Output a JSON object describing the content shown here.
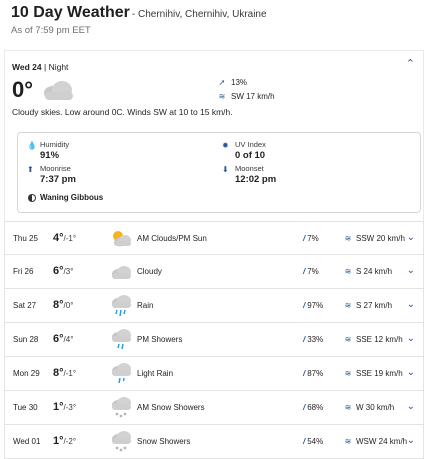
{
  "header": {
    "title": "10 Day Weather",
    "location": "- Chernihiv, Chernihiv, Ukraine",
    "as_of": "As of 7:59 pm EET"
  },
  "today": {
    "day": "Wed 24",
    "separator": "|",
    "period": "Night",
    "temp": "0°",
    "precip": "13%",
    "wind": "SW 17 km/h",
    "summary": "Cloudy skies. Low around 0C. Winds SW at 10 to 15 km/h.",
    "humidity_label": "Humidity",
    "humidity_value": "91%",
    "uv_label": "UV Index",
    "uv_value": "0 of 10",
    "moonrise_label": "Moonrise",
    "moonrise_value": "7:37 pm",
    "moonset_label": "Moonset",
    "moonset_value": "12:02 pm",
    "moon_phase": "Waning Gibbous",
    "collapse_icon": "chevron-up-icon"
  },
  "days": [
    {
      "day": "Thu 25",
      "hi": "4°",
      "lo": "/-1°",
      "icon": "partly-cloudy-icon",
      "cond": "AM Clouds/PM Sun",
      "precip": "7%",
      "wind": "SSW 20 km/h"
    },
    {
      "day": "Fri 26",
      "hi": "6°",
      "lo": "/3°",
      "icon": "cloud-icon",
      "cond": "Cloudy",
      "precip": "7%",
      "wind": "S 24 km/h"
    },
    {
      "day": "Sat 27",
      "hi": "8°",
      "lo": "/0°",
      "icon": "rain-icon",
      "cond": "Rain",
      "precip": "97%",
      "wind": "S 27 km/h"
    },
    {
      "day": "Sun 28",
      "hi": "6°",
      "lo": "/4°",
      "icon": "showers-icon",
      "cond": "PM Showers",
      "precip": "33%",
      "wind": "SSE 12 km/h"
    },
    {
      "day": "Mon 29",
      "hi": "8°",
      "lo": "/-1°",
      "icon": "light-rain-icon",
      "cond": "Light Rain",
      "precip": "87%",
      "wind": "SSE 19 km/h"
    },
    {
      "day": "Tue 30",
      "hi": "1°",
      "lo": "/-3°",
      "icon": "snow-showers-icon",
      "cond": "AM Snow Showers",
      "precip": "68%",
      "wind": "W 30 km/h"
    },
    {
      "day": "Wed 01",
      "hi": "1°",
      "lo": "/-2°",
      "icon": "snow-showers-icon",
      "cond": "Snow Showers",
      "precip": "54%",
      "wind": "WSW 24 km/h"
    }
  ],
  "colors": {
    "accent": "#2b5797",
    "cloud": "#c8c8c8",
    "rain": "#2b9bd6",
    "sun": "#f2b51e"
  }
}
